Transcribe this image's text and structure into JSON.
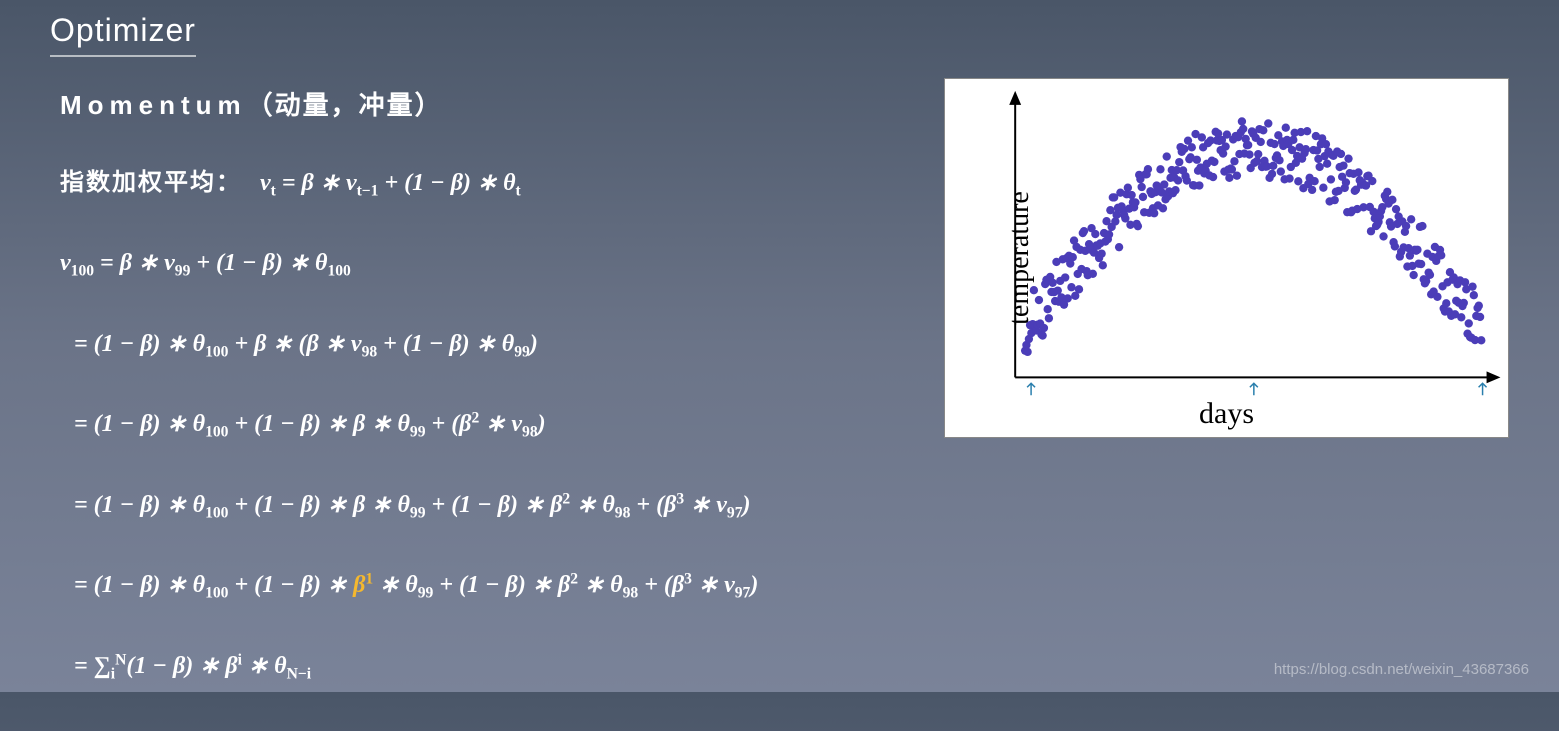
{
  "title": "Optimizer",
  "heading_en": "Momentum",
  "heading_zh": "（动量，冲量）",
  "label_ewa": "指数加权平均：",
  "chart": {
    "xlabel": "days",
    "ylabel": "temperature"
  },
  "formulas": {
    "f1_pre": "v",
    "f1_sub1": "t",
    "f1_mid1": " = β ∗ v",
    "f1_sub2": "t−1",
    "f1_mid2": " + (1 − β) ∗ θ",
    "f1_sub3": "t",
    "f2_pre": "v",
    "f2_sub1": "100",
    "f2_mid1": " = β ∗ v",
    "f2_sub2": "99",
    "f2_mid2": " + (1 − β) ∗ θ",
    "f2_sub3": "100",
    "f3": " = (1 − β) ∗ θ",
    "f3_s1": "100",
    "f3_m1": " + β ∗ (β ∗ v",
    "f3_s2": "98",
    "f3_m2": " + (1 − β) ∗ θ",
    "f3_s3": "99",
    "f3_m3": ")",
    "f4": " = (1 − β) ∗ θ",
    "f4_s1": "100",
    "f4_m1": " + (1 − β) ∗ β ∗ θ",
    "f4_s2": "99",
    "f4_m2": " + (β",
    "f4_sup1": "2",
    "f4_m3": " ∗ v",
    "f4_s3": "98",
    "f4_m4": ")",
    "f5": " = (1 − β) ∗ θ",
    "f5_s1": "100",
    "f5_m1": " + (1 − β) ∗ β ∗ θ",
    "f5_s2": "99",
    "f5_m2": " + (1 − β) ∗ β",
    "f5_sup1": "2",
    "f5_m3": " ∗ θ",
    "f5_s3": "98",
    "f5_m4": "  + (β",
    "f5_sup2": "3",
    "f5_m5": " ∗ v",
    "f5_s4": "97",
    "f5_m6": ")",
    "f6": " = (1 − β) ∗ θ",
    "f6_s1": "100",
    "f6_m1": " + (1 − β) ∗ ",
    "f6_orange_b": "β",
    "f6_orange_sup": "1",
    "f6_m2": " ∗ θ",
    "f6_s2": "99",
    "f6_m3": " + (1 − β) ∗ β",
    "f6_sup1": "2",
    "f6_m4": " ∗ θ",
    "f6_s3": "98",
    "f6_m5": "  + (β",
    "f6_sup2": "3",
    "f6_m6": " ∗ v",
    "f6_s4": "97",
    "f6_m7": ")",
    "f7_pre": " = ∑",
    "f7_sub1": "i",
    "f7_sup1": "N",
    "f7_m1": "(1 − β) ∗ β",
    "f7_sup2": "i",
    "f7_m2": " ∗ θ",
    "f7_sub2": "N−i"
  },
  "watermark": "https://blog.csdn.net/weixin_43687366"
}
